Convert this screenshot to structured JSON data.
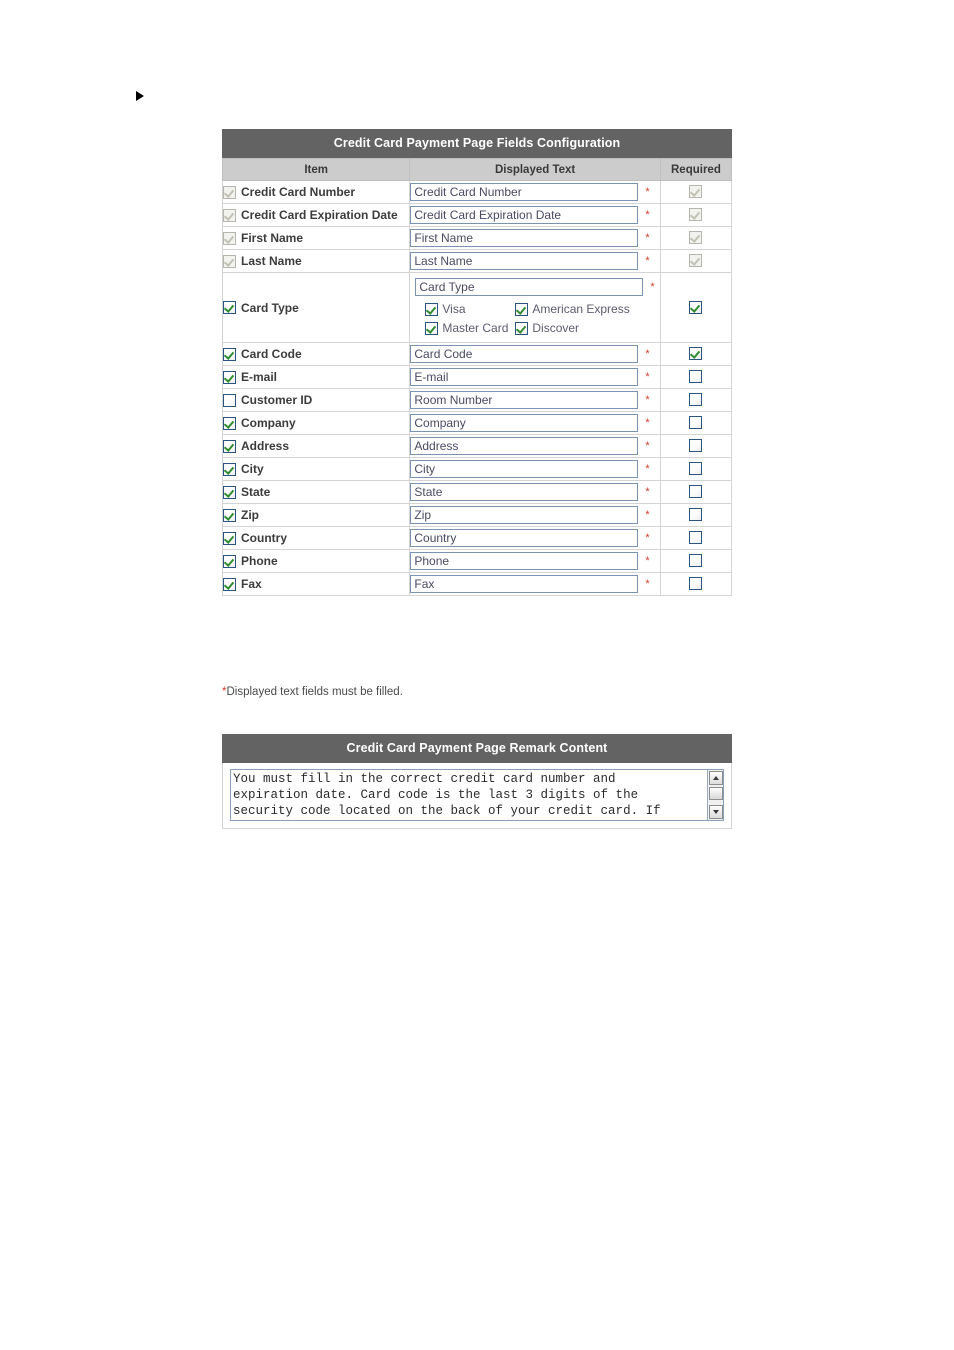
{
  "bullet": {
    "icon": "arrow-right-bullet"
  },
  "fields_panel": {
    "title": "Credit Card Payment Page Fields Configuration",
    "columns": {
      "item": "Item",
      "displayed_text": "Displayed Text",
      "required": "Required"
    },
    "rows": [
      {
        "label": "Credit Card Number",
        "enabled": true,
        "locked": true,
        "text": "Credit Card Number",
        "required": true,
        "required_locked": true
      },
      {
        "label": "Credit Card Expiration Date",
        "enabled": true,
        "locked": true,
        "text": "Credit Card Expiration Date",
        "required": true,
        "required_locked": true
      },
      {
        "label": "First Name",
        "enabled": true,
        "locked": true,
        "text": "First Name",
        "required": true,
        "required_locked": true
      },
      {
        "label": "Last Name",
        "enabled": true,
        "locked": true,
        "text": "Last Name",
        "required": true,
        "required_locked": true
      },
      {
        "label": "Card Code",
        "enabled": true,
        "locked": false,
        "text": "Card Code",
        "required": true,
        "required_locked": false
      },
      {
        "label": "E-mail",
        "enabled": true,
        "locked": false,
        "text": "E-mail",
        "required": false,
        "required_locked": false
      },
      {
        "label": "Customer ID",
        "enabled": false,
        "locked": false,
        "text": "Room Number",
        "required": false,
        "required_locked": false
      },
      {
        "label": "Company",
        "enabled": true,
        "locked": false,
        "text": "Company",
        "required": false,
        "required_locked": false
      },
      {
        "label": "Address",
        "enabled": true,
        "locked": false,
        "text": "Address",
        "required": false,
        "required_locked": false
      },
      {
        "label": "City",
        "enabled": true,
        "locked": false,
        "text": "City",
        "required": false,
        "required_locked": false
      },
      {
        "label": "State",
        "enabled": true,
        "locked": false,
        "text": "State",
        "required": false,
        "required_locked": false
      },
      {
        "label": "Zip",
        "enabled": true,
        "locked": false,
        "text": "Zip",
        "required": false,
        "required_locked": false
      },
      {
        "label": "Country",
        "enabled": true,
        "locked": false,
        "text": "Country",
        "required": false,
        "required_locked": false
      },
      {
        "label": "Phone",
        "enabled": true,
        "locked": false,
        "text": "Phone",
        "required": false,
        "required_locked": false
      },
      {
        "label": "Fax",
        "enabled": true,
        "locked": false,
        "text": "Fax",
        "required": false,
        "required_locked": false
      }
    ],
    "card_type_row": {
      "label": "Card Type",
      "enabled": true,
      "text": "Card Type",
      "required": true,
      "options": [
        {
          "label": "Visa",
          "checked": true
        },
        {
          "label": "American Express",
          "checked": true
        },
        {
          "label": "Master Card",
          "checked": true
        },
        {
          "label": "Discover",
          "checked": true
        }
      ]
    },
    "required_marker": "*",
    "footnote_star": "*",
    "footnote": "Displayed text fields must be filled."
  },
  "remark_panel": {
    "title": "Credit Card Payment Page Remark Content",
    "content": "You must fill in the correct credit card number and\nexpiration date. Card code is the last 3 digits of the\nsecurity code located on the back of your credit card. If"
  },
  "colors": {
    "panel_header_bg": "#636363",
    "column_header_bg": "#cccccc",
    "checkbox_border": "#2b5580",
    "check_green": "#2f8c2f",
    "required_star": "#d23b2c",
    "input_border": "#7b93b3",
    "input_text": "#4a4a63"
  }
}
